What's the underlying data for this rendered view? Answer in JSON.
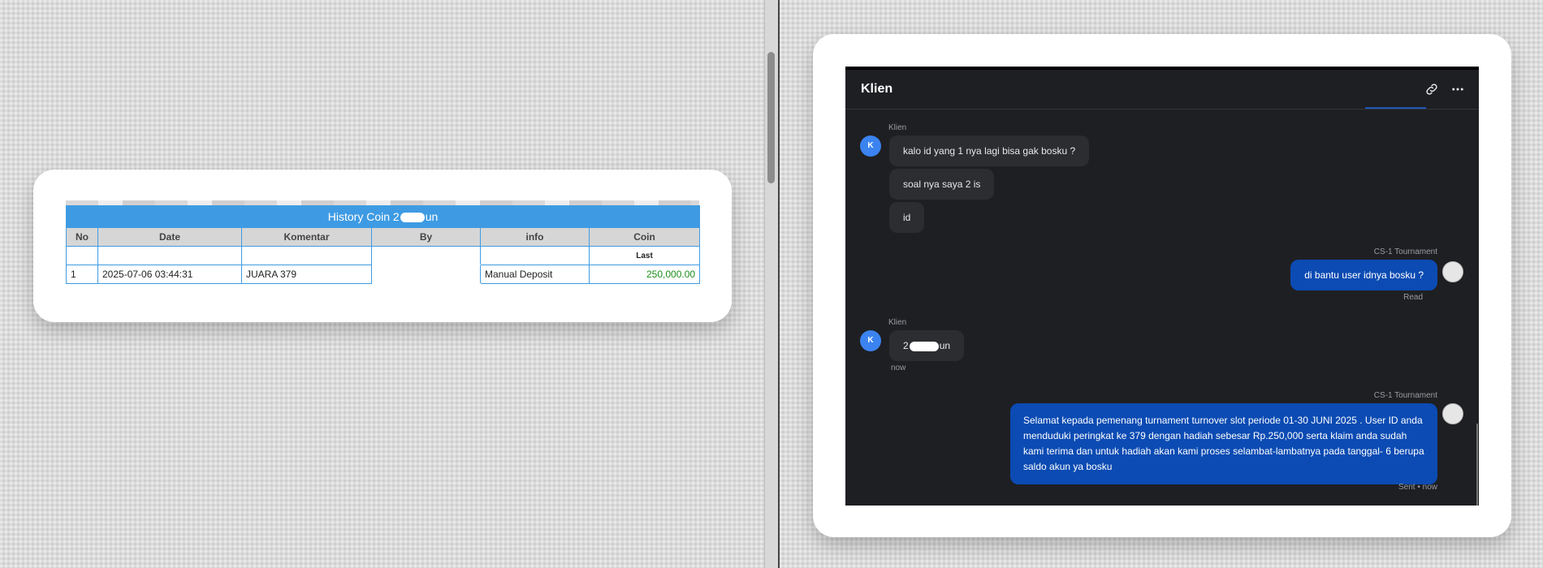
{
  "history": {
    "title_prefix": "History Coin 2",
    "title_suffix": "un",
    "columns": [
      "No",
      "Date",
      "Komentar",
      "By",
      "info",
      "Coin"
    ],
    "sub_header": "Last",
    "rows": [
      {
        "no": "1",
        "date": "2025-07-06 03:44:31",
        "komentar": "JUARA 379",
        "by": "",
        "info": "Manual Deposit",
        "coin": "250,000.00"
      }
    ]
  },
  "chat": {
    "title": "Klien",
    "icons": {
      "link": "link-icon",
      "more": "more-icon"
    },
    "avatar_initial": "K",
    "messages": {
      "m1_sender": "Klien",
      "m1_text": "kalo id yang 1 nya lagi bisa gak bosku ?",
      "m2_text": "soal nya saya 2 is",
      "m3_text": "id",
      "m4_sender": "CS-1 Tournament",
      "m4_text": "di bantu user idnya bosku ?",
      "m4_status": "Read",
      "m5_sender": "Klien",
      "m5_prefix": "2",
      "m5_suffix": "un",
      "m5_time": "now",
      "m6_sender": "CS-1 Tournament",
      "m6_text": "Selamat kepada pemenang turnament turnover slot periode 01-30 JUNI 2025 . User ID anda menduduki peringkat ke 379 dengan hadiah sebesar Rp.250,000 serta klaim anda sudah kami terima dan untuk hadiah akan kami proses selambat-lambatnya pada tanggal- 6 berupa saldo akun ya bosku",
      "m6_status": "Sent • now"
    }
  },
  "colors": {
    "table_accent": "#3e9be3",
    "coin_value": "#1a8d1a",
    "chat_bg": "#1e1f22",
    "bubble_in": "#2b2d31",
    "bubble_out": "#0b4bb3",
    "avatar": "#3b83f0"
  }
}
